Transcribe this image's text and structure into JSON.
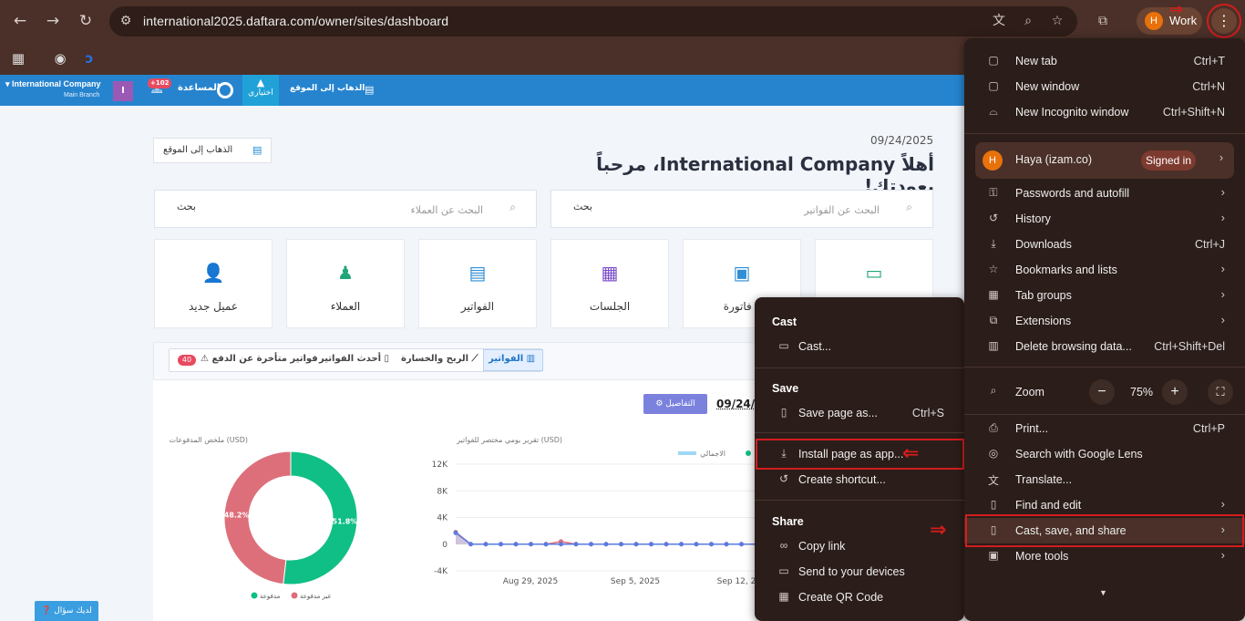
{
  "browser": {
    "url": "international2025.daftara.com/owner/sites/dashboard",
    "profile_label": "Work",
    "profile_initial": "H"
  },
  "appbar": {
    "company": "International Company",
    "branch": "Main Branch",
    "user_initial": "I",
    "notif_count": "+102",
    "help": "المساعدة",
    "trial": "اختياري",
    "goto_site": "الذهاب إلى الموقع"
  },
  "dashboard": {
    "date": "09/24/2025",
    "welcome": "أهلاً International Company، مرحباً بعودتك!",
    "goto_site_button": "الذهاب إلى الموقع",
    "search_invoices": {
      "placeholder": "البحث عن الفواتير",
      "button": "بحث"
    },
    "search_clients": {
      "placeholder": "البحث عن العملاء",
      "button": "بحث"
    },
    "cards": [
      {
        "label": "عميل جديد",
        "icon": "add-user-icon",
        "color": "#2f8ed6"
      },
      {
        "label": "العملاء",
        "icon": "clients-icon",
        "color": "#21a67a"
      },
      {
        "label": "الفواتير",
        "icon": "invoices-icon",
        "color": "#2f8ed6"
      },
      {
        "label": "الجلسات",
        "icon": "sessions-icon",
        "color": "#7a4ec9"
      },
      {
        "label": "ء فاتورة",
        "icon": "new-invoice-icon",
        "color": "#2f8ed6"
      },
      {
        "label": "",
        "icon": "pos-icon",
        "color": "#21a67a"
      }
    ],
    "tabs": {
      "invoices": "الفواتير",
      "profit_loss": "الربح والخسارة",
      "latest_invoices": "أحدث الفواتير",
      "late_invoices": "فواتير متأخرة عن الدفع",
      "late_count": "40"
    },
    "details_button": "التفاصيل",
    "details_date": "09/24/2",
    "ask_button": "لديك سؤال"
  },
  "chart_data": [
    {
      "type": "pie",
      "title": "ملخص المدفوعات (USD)",
      "labels": [
        "مدفوعة",
        "غير مدفوعة"
      ],
      "values": [
        51.8,
        48.2
      ],
      "value_labels": [
        "51.8%",
        "48.2%"
      ],
      "colors": [
        "#10bf85",
        "#dd6f7a"
      ],
      "legend": "bottom"
    },
    {
      "type": "line",
      "title": "تقرير يومي مختصر للفواتير (USD)",
      "legend_entries": [
        "الاجمالي"
      ],
      "x_ticks": [
        "Aug 29, 2025",
        "Sep 5, 2025",
        "Sep 12, 2"
      ],
      "y_ticks": [
        "12K",
        "8K",
        "4K",
        "0",
        "-4K"
      ],
      "ylim": [
        -4000,
        12000
      ],
      "series": [
        {
          "name": "الاجمالي",
          "color": "#5b7be0",
          "values": [
            1700,
            0,
            0,
            0,
            0,
            0,
            0,
            0,
            0,
            0,
            0,
            0,
            0,
            0,
            0,
            0,
            0,
            0,
            0,
            0,
            0
          ]
        },
        {
          "name": "",
          "color": "#dd6f7a",
          "values": [
            1800,
            0,
            0,
            0,
            0,
            0,
            0,
            400,
            0,
            0,
            0,
            0,
            0,
            0,
            0,
            0,
            0,
            0,
            0,
            0,
            0
          ]
        }
      ]
    }
  ],
  "cast_menu": {
    "cast_header": "Cast",
    "cast": "Cast...",
    "save_header": "Save",
    "save_page": "Save page as...",
    "save_shortcut": "Ctrl+S",
    "install": "Install page as app...",
    "shortcut": "Create shortcut...",
    "share_header": "Share",
    "copy_link": "Copy link",
    "send": "Send to your devices",
    "qr": "Create QR Code"
  },
  "main_menu": {
    "new_tab": "New tab",
    "new_tab_sc": "Ctrl+T",
    "new_window": "New window",
    "new_window_sc": "Ctrl+N",
    "incognito": "New Incognito window",
    "incognito_sc": "Ctrl+Shift+N",
    "profile_name": "Haya  (izam.co)",
    "signed_in": "Signed in",
    "passwords": "Passwords and autofill",
    "history": "History",
    "downloads": "Downloads",
    "downloads_sc": "Ctrl+J",
    "bookmarks": "Bookmarks and lists",
    "tab_groups": "Tab groups",
    "extensions": "Extensions",
    "delete": "Delete browsing data...",
    "delete_sc": "Ctrl+Shift+Del",
    "zoom": "Zoom",
    "zoom_value": "75%",
    "print": "Print...",
    "print_sc": "Ctrl+P",
    "lens": "Search with Google Lens",
    "translate": "Translate...",
    "find": "Find and edit",
    "cast": "Cast, save, and share",
    "more_tools": "More tools"
  }
}
